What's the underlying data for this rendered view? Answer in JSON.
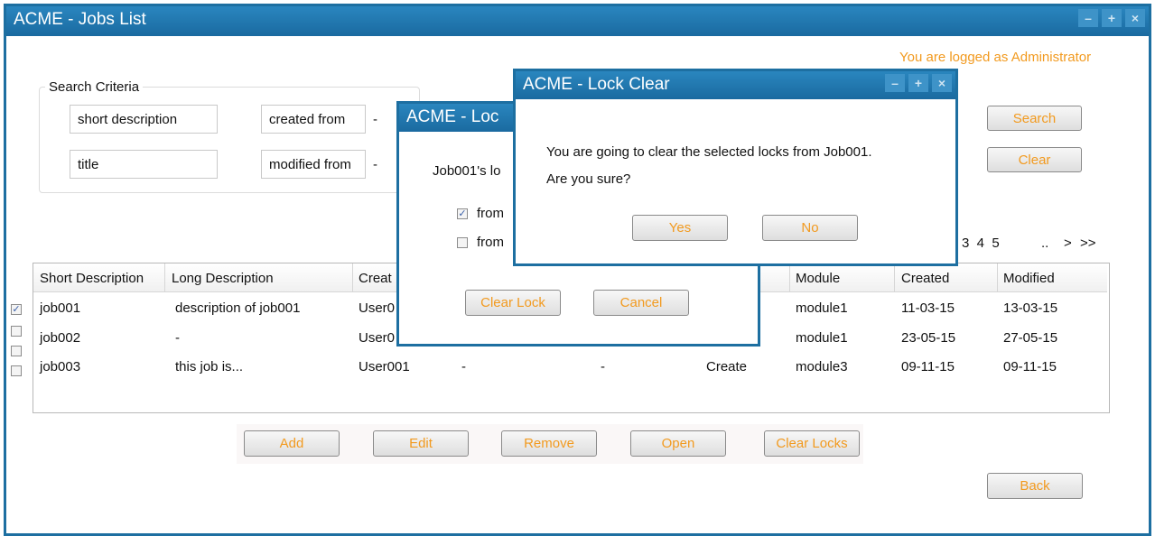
{
  "main": {
    "title": "ACME - Jobs List",
    "controls": [
      "–",
      "+",
      "×"
    ],
    "logged_as": "You are logged as Administrator",
    "search": {
      "legend": "Search Criteria",
      "short_description": "short description",
      "title": "title",
      "created_from": "created from",
      "modified_from": "modified from",
      "dash": "-",
      "search_label": "Search",
      "clear_label": "Clear"
    },
    "pagination": {
      "pages": "3  4  5",
      "ellipsis": "..",
      "next": ">",
      "last": ">>"
    },
    "table": {
      "headers": [
        "Short Description",
        "Long Description",
        "Creat",
        "Module",
        "Created",
        "Modified"
      ],
      "rows": [
        {
          "short": "job001",
          "long": "description of job001",
          "creator": "User0",
          "c4": "",
          "c5": "",
          "action": "",
          "module": "module1",
          "created": "11-03-15",
          "modified": "13-03-15",
          "checked": true
        },
        {
          "short": "job002",
          "long": "-",
          "creator": "User0",
          "c4": "",
          "c5": "",
          "action": "",
          "module": "module1",
          "created": "23-05-15",
          "modified": "27-05-15",
          "checked": false
        },
        {
          "short": "job003",
          "long": "this job is...",
          "creator": "User001",
          "c4": "-",
          "c5": "-",
          "action": "Create",
          "module": "module3",
          "created": "09-11-15",
          "modified": "09-11-15",
          "checked": false
        }
      ]
    },
    "actions": {
      "add": "Add",
      "edit": "Edit",
      "remove": "Remove",
      "open": "Open",
      "clear_locks": "Clear Locks",
      "back": "Back"
    }
  },
  "lock_dialog": {
    "title": "ACME - Loc",
    "message": "Job001's lo",
    "options": [
      {
        "label": "from",
        "checked": true
      },
      {
        "label": "from",
        "checked": false
      }
    ],
    "clear_lock": "Clear Lock",
    "cancel": "Cancel"
  },
  "confirm_dialog": {
    "title": "ACME - Lock Clear",
    "line1": "You are going to clear the selected locks from Job001.",
    "line2": "Are you sure?",
    "yes": "Yes",
    "no": "No"
  },
  "colors": {
    "titlebar": "#1d6fa1",
    "accent": "#f29a1f"
  }
}
